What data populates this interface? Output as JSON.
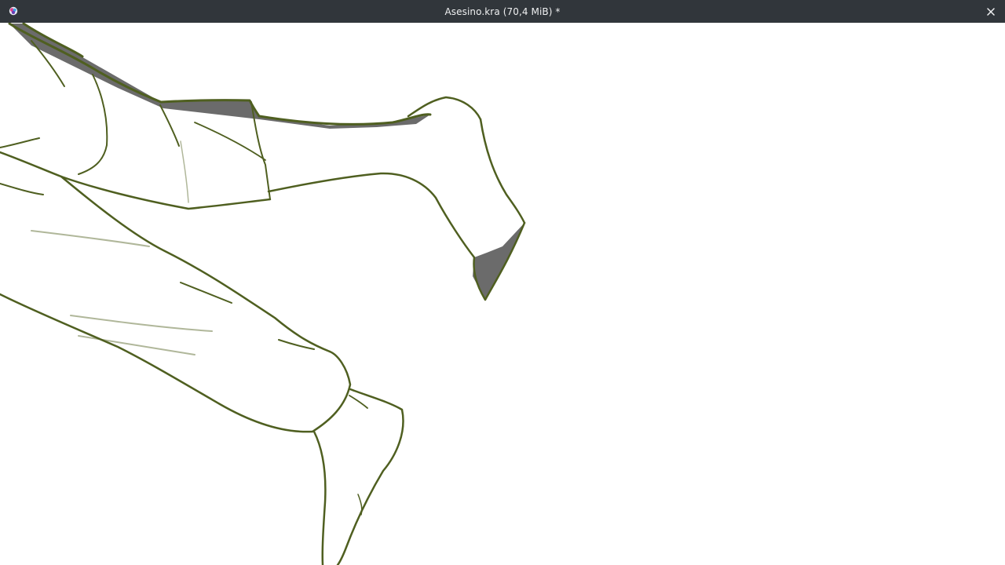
{
  "window": {
    "title": "Asesino.kra (70,4 MiB) *",
    "app_icon": "krita-logo-icon",
    "close_icon": "close-icon"
  },
  "colors": {
    "titlebar": "#31363b",
    "title_text": "#eff0f1",
    "canvas": "#ffffff",
    "ink": "#4f5f20",
    "shade": "#6b6b6b"
  }
}
